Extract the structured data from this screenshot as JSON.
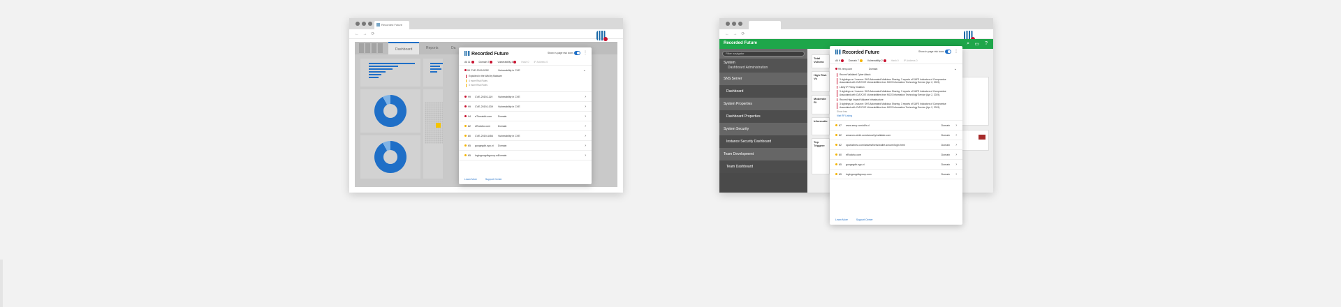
{
  "left_window": {
    "tab_title": "Recorded Future",
    "dashboard_tabs": [
      "Dashboard",
      "Reports",
      "Da"
    ]
  },
  "right_window": {
    "brand": "Recorded Future",
    "filter_placeholder": "Filter navigator",
    "sidebar": {
      "system": "System",
      "system_sub": "Dashboard Administration",
      "items": [
        {
          "label": "SNS Server",
          "kind": "sec"
        },
        {
          "label": "Dashboard",
          "kind": "sub"
        },
        {
          "label": "System Properties",
          "kind": "sec"
        },
        {
          "label": "Dashboard Properties",
          "kind": "sub"
        },
        {
          "label": "System Security",
          "kind": "sec"
        },
        {
          "label": "Instance Security Dashboard",
          "kind": "sub"
        },
        {
          "label": "Team Development",
          "kind": "sec"
        },
        {
          "label": "Team Dashboard",
          "kind": "sub"
        }
      ]
    },
    "cards": [
      "Total Vulnera",
      "High Risk Vu",
      "Moderate Ri",
      "Informatio",
      "Top Triggere"
    ]
  },
  "panel_left": {
    "logo": "Recorded Future",
    "toggle_label": "Show in-page risk icons",
    "filters": [
      {
        "label": "All 11",
        "badge": "#c8102e",
        "dim": false
      },
      {
        "label": "Domain 7",
        "badge": "#c8102e",
        "dim": false
      },
      {
        "label": "Vulnerability 4",
        "badge": "#c8102e",
        "dim": false
      },
      {
        "label": "Hash 0",
        "badge": "",
        "dim": true
      },
      {
        "label": "IP Address 0",
        "badge": "",
        "dim": true
      }
    ],
    "expanded": {
      "score": "99",
      "name": "CVE-2019-0292",
      "type": "Vulnerability in CVE",
      "rules": [
        {
          "text": "Exploited in the Wild by Malware",
          "level": "red"
        },
        {
          "text": "4 more Risk Rules",
          "level": "yellow"
        },
        {
          "text": "3 more Risk Rules",
          "level": "yellow"
        }
      ]
    },
    "rows": [
      {
        "score": "99",
        "name": "CVE-2019-1119",
        "type": "Vulnerability in CVE",
        "color": "#c8102e"
      },
      {
        "score": "99",
        "name": "CVE-2019-1039",
        "type": "Vulnerability in CVE",
        "color": "#c8102e"
      },
      {
        "score": "94",
        "name": "eThreatdb.com",
        "type": "Domain",
        "color": "#c8102e"
      },
      {
        "score": "82",
        "name": "eRodcho.com",
        "type": "Domain",
        "color": "#f5b400"
      },
      {
        "score": "80",
        "name": "CVE-2019-4456",
        "type": "Vulnerability in CVE",
        "color": "#f5b400"
      },
      {
        "score": "65",
        "name": "googegdb.nyp.ct",
        "type": "Domain",
        "color": "#f5b400"
      },
      {
        "score": "65",
        "name": "logingoogdbgroup.co",
        "type": "Domain",
        "color": "#f5b400"
      }
    ],
    "footer": {
      "learn": "Learn More",
      "support": "Support Center"
    }
  },
  "panel_right": {
    "logo": "Recorded Future",
    "toggle_label": "Show in-page risk icons",
    "filters": [
      {
        "label": "All 9",
        "badge": "#c8102e",
        "dim": false
      },
      {
        "label": "Domain 7",
        "badge": "#f5b400",
        "dim": false
      },
      {
        "label": "Vulnerability 2",
        "badge": "#c8102e",
        "dim": false
      },
      {
        "label": "Hash 0",
        "badge": "",
        "dim": true
      },
      {
        "label": "IP Address 0",
        "badge": "",
        "dim": true
      }
    ],
    "expanded": {
      "score": "99",
      "name": "zeny.com",
      "type": "Domain",
      "rules": [
        {
          "text": "Recent Validated Cyber Attack",
          "level": "red"
        },
        {
          "text": "3 sightings on 1 source: SHS Automated Malicious Sharing. 3 reports of SAFE Indicators of Compromise Associated with CVE/CVE Vulnerabilities from MCIS Information Technology Service (Apr 2, 2019).",
          "level": "red"
        },
        {
          "text": "Likely IP Policy Violation",
          "level": "red"
        },
        {
          "text": "3 sightings on 1 source: SHS Automated Malicious Sharing. 3 reports of SAFE Indicators of Compromise Associated with CVE/CVE Vulnerabilities from MCIS Information Technology Service (Apr 2, 2019).",
          "level": "red"
        },
        {
          "text": "Recent High Impact Malware Infrastructure",
          "level": "red"
        },
        {
          "text": "3 sightings on 1 source: SHS Automated Malicious Sharing. 3 reports of SAFE Indicators of Compromise Associated with CVE/CVE Vulnerabilities from MCIS Information Technology Service (Apr 2, 2019).",
          "level": "red"
        }
      ],
      "show_less": "Show less",
      "link": "Visit RF Listing"
    },
    "rows": [
      {
        "score": "87",
        "name": "www.zeny.com/dl/x.cl",
        "type": "Domain",
        "color": "#f5b400"
      },
      {
        "score": "82",
        "name": "amazon-winkl.com/security/validate.com",
        "type": "Domain",
        "color": "#f5b400"
      },
      {
        "score": "82",
        "name": "sparkzlinea.com/assets/fonts/wallet-secure/login.html",
        "type": "Domain",
        "color": "#f5b400"
      },
      {
        "score": "80",
        "name": "eRodcho.com",
        "type": "Domain",
        "color": "#f5b400"
      },
      {
        "score": "65",
        "name": "googegdb.nyp.ct",
        "type": "Domain",
        "color": "#f5b400"
      },
      {
        "score": "65",
        "name": "logingoogdbgroup.com",
        "type": "Domain",
        "color": "#f5b400"
      }
    ],
    "footer": {
      "learn": "Learn More",
      "support": "Support Center"
    }
  }
}
